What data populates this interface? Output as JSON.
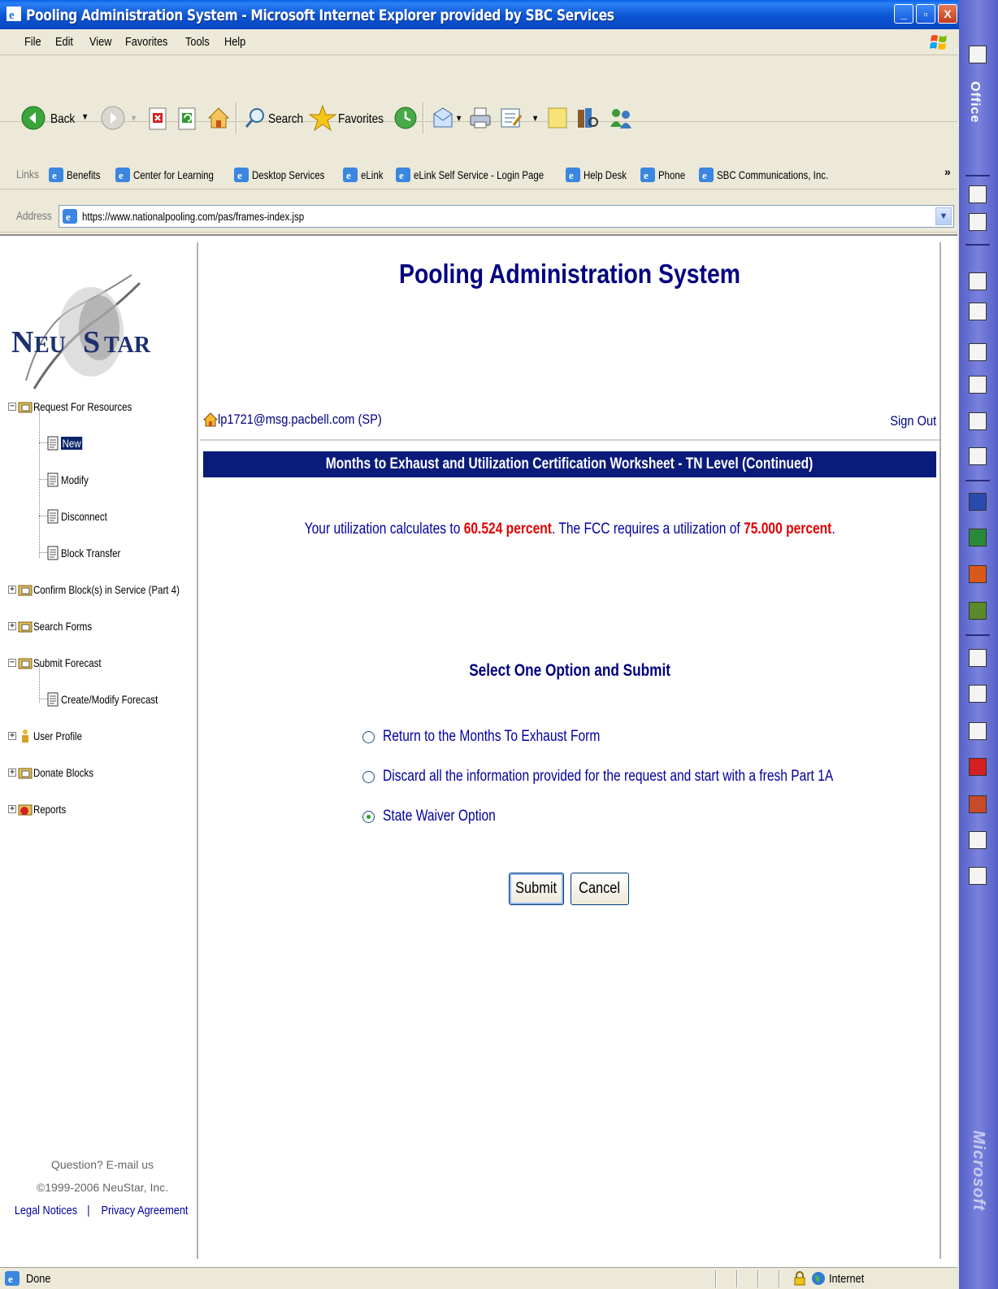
{
  "window": {
    "title": "Pooling Administration System - Microsoft Internet Explorer provided by SBC Services"
  },
  "menu": [
    "File",
    "Edit",
    "View",
    "Favorites",
    "Tools",
    "Help"
  ],
  "toolbar": {
    "back_label": "Back",
    "search_label": "Search",
    "favorites_label": "Favorites"
  },
  "links": {
    "label": "Links",
    "items": [
      "Benefits",
      "Center for Learning",
      "Desktop Services",
      "eLink",
      "eLink Self Service - Login Page",
      "Help Desk",
      "Phone",
      "SBC Communications, Inc."
    ]
  },
  "address": {
    "label": "Address",
    "url": "https://www.nationalpooling.com/pas/frames-index.jsp"
  },
  "sidebar": {
    "logo_text": "NEUSTAR",
    "tree": [
      {
        "label": "Request For Resources",
        "expander": "−",
        "level": 0,
        "icon": "folder-icon"
      },
      {
        "label": "New",
        "level": 1,
        "icon": "document-icon",
        "selected": true
      },
      {
        "label": "Modify",
        "level": 1,
        "icon": "document-icon"
      },
      {
        "label": "Disconnect",
        "level": 1,
        "icon": "document-icon"
      },
      {
        "label": "Block Transfer",
        "level": 1,
        "icon": "document-icon"
      },
      {
        "label": "Confirm Block(s) in Service (Part 4)",
        "expander": "+",
        "level": 0,
        "icon": "folder-icon"
      },
      {
        "label": "Search Forms",
        "expander": "+",
        "level": 0,
        "icon": "folder-icon"
      },
      {
        "label": "Submit Forecast",
        "expander": "−",
        "level": 0,
        "icon": "folder-icon"
      },
      {
        "label": "Create/Modify Forecast",
        "level": 1,
        "icon": "document-icon"
      },
      {
        "label": "User Profile",
        "expander": "+",
        "level": 0,
        "icon": "user-icon"
      },
      {
        "label": "Donate Blocks",
        "expander": "+",
        "level": 0,
        "icon": "folder-icon"
      },
      {
        "label": "Reports",
        "expander": "+",
        "level": 0,
        "icon": "reports-icon"
      }
    ],
    "footer_question": "Question? E-mail us",
    "footer_copyright": "©1999-2006 NeuStar, Inc.",
    "legal_notices": "Legal Notices",
    "separator": "|",
    "privacy": "Privacy Agreement"
  },
  "main": {
    "title": "Pooling Administration System",
    "user": "lp1721@msg.pacbell.com (SP)",
    "sign_out": "Sign Out",
    "banner": "Months to Exhaust and Utilization Certification Worksheet - TN Level (Continued)",
    "util_prefix": "Your utilization calculates to ",
    "util_value": "60.524 percent",
    "util_middle": ". The FCC requires a utilization of ",
    "util_required": "75.000 percent",
    "util_suffix": ".",
    "select_title": "Select One Option and Submit",
    "options": [
      {
        "label": "Return to the Months To Exhaust Form",
        "selected": false
      },
      {
        "label": "Discard all the information provided for the request and start with a fresh Part 1A",
        "selected": false
      },
      {
        "label": "State Waiver Option",
        "selected": true
      }
    ],
    "submit_label": "Submit",
    "cancel_label": "Cancel"
  },
  "status": {
    "text": "Done",
    "zone": "Internet"
  },
  "office_bar": {
    "top_label": "Office",
    "bottom_label": "Microsoft"
  },
  "colors": {
    "titlebar": "#0b55d4",
    "banner": "#0a1b7a",
    "link_text": "#0000a0",
    "highlight_red": "#e00000"
  }
}
